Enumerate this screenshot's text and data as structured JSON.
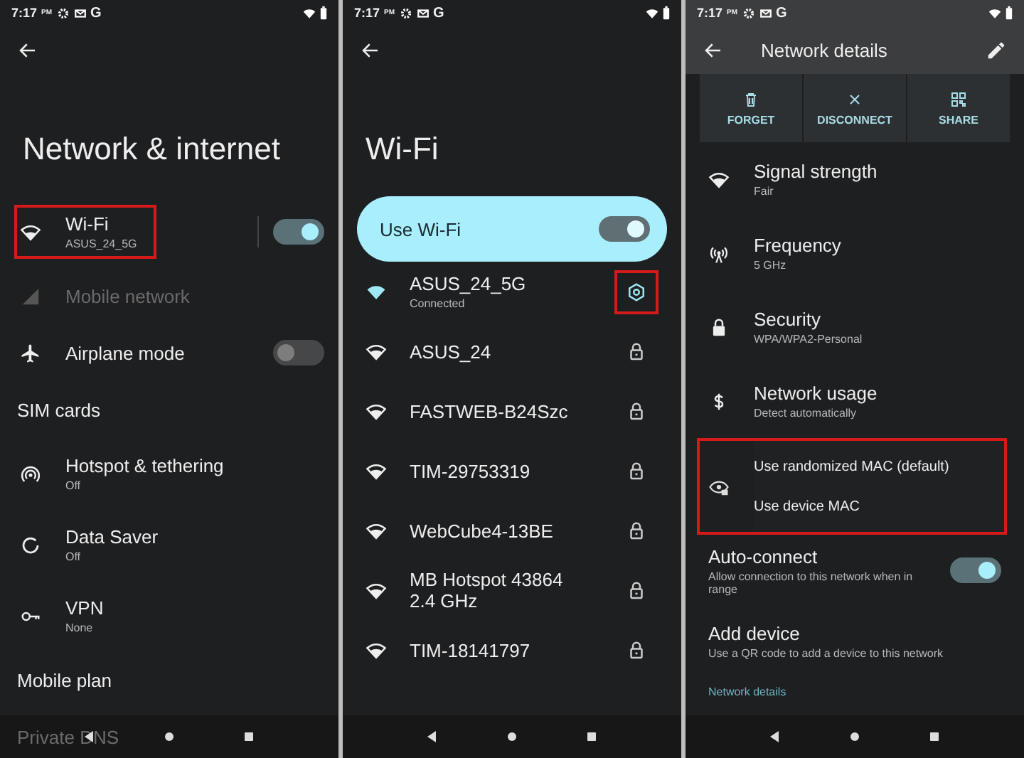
{
  "panels": [
    {
      "kind": "menu",
      "status_bar": {
        "time": "7:17",
        "meridiem": "PM",
        "letter": "G"
      },
      "title": "Network & internet",
      "items": [
        {
          "kind": "wifi",
          "label": "Wi-Fi",
          "sub": "ASUS_24_5G",
          "toggle": {
            "on": true
          },
          "highlighted": true,
          "disabled": false
        },
        {
          "kind": "cellular",
          "label": "Mobile network",
          "highlighted": false,
          "disabled": true
        },
        {
          "kind": "airplane",
          "label": "Airplane mode",
          "toggle": {
            "on": false
          },
          "highlighted": false,
          "disabled": false
        },
        {
          "kind": "header",
          "label": "SIM cards",
          "highlighted": false,
          "disabled": false
        },
        {
          "kind": "hotspot",
          "label": "Hotspot & tethering",
          "sub": "Off",
          "highlighted": false,
          "disabled": false
        },
        {
          "kind": "saver",
          "label": "Data Saver",
          "sub": "Off",
          "highlighted": false,
          "disabled": false
        },
        {
          "kind": "vpn",
          "label": "VPN",
          "sub": "None",
          "highlighted": false,
          "disabled": false
        },
        {
          "kind": "header",
          "label": "Mobile plan",
          "highlighted": false,
          "disabled": false
        },
        {
          "kind": "header",
          "label": "Private DNS",
          "highlighted": false,
          "disabled": false
        }
      ]
    },
    {
      "kind": "wifi",
      "status_bar": {
        "time": "7:17",
        "meridiem": "PM",
        "letter": "G"
      },
      "title": "Wi-Fi",
      "master": {
        "label": "Use Wi-Fi",
        "on": true
      },
      "networks": [
        {
          "name": "ASUS_24_5G",
          "sub": "Connected",
          "connected": true,
          "highlighted": true
        },
        {
          "name": "ASUS_24",
          "connected": false,
          "highlighted": false
        },
        {
          "name": "FASTWEB-B24Szc",
          "connected": false,
          "highlighted": false
        },
        {
          "name": "TIM-29753319",
          "connected": false,
          "highlighted": false
        },
        {
          "name": "WebCube4-13BE",
          "connected": false,
          "highlighted": false
        },
        {
          "name": "MB Hotspot 43864 2.4 GHz",
          "connected": false,
          "highlighted": false
        },
        {
          "name": "TIM-18141797",
          "connected": false,
          "highlighted": false
        }
      ]
    },
    {
      "kind": "details",
      "status_bar": {
        "time": "7:17",
        "meridiem": "PM",
        "letter": "G"
      },
      "title": "Network details",
      "actions": [
        {
          "kind": "forget",
          "label": "FORGET"
        },
        {
          "kind": "disconnect",
          "label": "DISCONNECT"
        },
        {
          "kind": "share",
          "label": "SHARE"
        }
      ],
      "rows": [
        {
          "kind": "signal",
          "label": "Signal strength",
          "sub": "Fair"
        },
        {
          "kind": "frequency",
          "label": "Frequency",
          "sub": "5 GHz"
        },
        {
          "kind": "security",
          "label": "Security",
          "sub": "WPA/WPA2-Personal"
        },
        {
          "kind": "usage",
          "label": "Network usage",
          "sub": "Detect automatically"
        }
      ],
      "mac_menu": {
        "highlighted": true,
        "options": [
          "Use randomized MAC (default)",
          "Use device MAC"
        ]
      },
      "auto_connect": {
        "label": "Auto-connect",
        "sub": "Allow connection to this network when in range",
        "on": true
      },
      "add_device": {
        "label": "Add device",
        "sub": "Use a QR code to add a device to this network"
      },
      "section": "Network details"
    }
  ]
}
